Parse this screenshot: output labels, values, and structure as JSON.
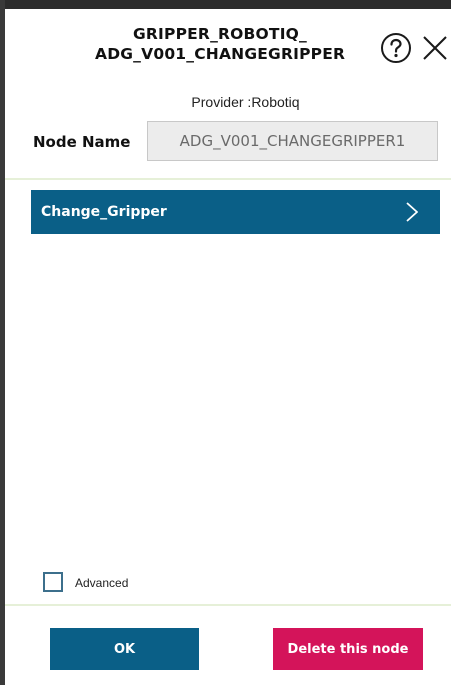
{
  "dialog": {
    "title_line1": "GRIPPER_ROBOTIQ_",
    "title_line2": "ADG_V001_CHANGEGRIPPER",
    "provider": "Provider :Robotiq",
    "help_icon": "question-circle-icon",
    "close_icon": "close-icon"
  },
  "node": {
    "label": "Node Name",
    "value": "ADG_V001_CHANGEGRIPPER1"
  },
  "actions": [
    {
      "label": "Change_Gripper",
      "icon": "chevron-right-icon"
    }
  ],
  "advanced": {
    "label": "Advanced",
    "checked": false
  },
  "buttons": {
    "ok": "OK",
    "delete": "Delete this node"
  },
  "colors": {
    "primary": "#0a5f87",
    "danger": "#d4145a",
    "divider": "#e6f0d8"
  }
}
